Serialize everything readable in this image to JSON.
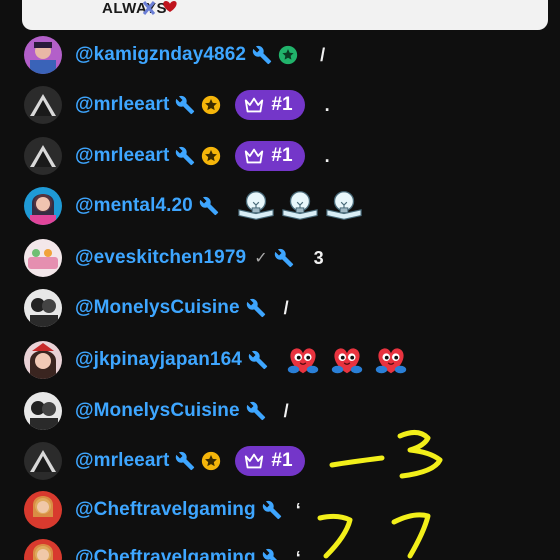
{
  "pinned": {
    "text": "ALWAYS"
  },
  "messages": [
    {
      "author": "@kamigznday4862",
      "text": "/",
      "badges": [
        "wrench-icon",
        "star-badge-icon"
      ]
    },
    {
      "author": "@mrleeart",
      "text": ".",
      "badges": [
        "wrench-icon",
        "gold-star-icon"
      ],
      "rank": "#1"
    },
    {
      "author": "@mrleeart",
      "text": ".",
      "badges": [
        "wrench-icon",
        "gold-star-icon"
      ],
      "rank": "#1"
    },
    {
      "author": "@mental4.20",
      "text": "",
      "badges": [
        "wrench-icon"
      ],
      "emoji": [
        "lightbulb-book-emoji",
        "lightbulb-book-emoji",
        "lightbulb-book-emoji"
      ]
    },
    {
      "author": "@eveskitchen1979",
      "text": "3",
      "badges": [
        "verified-check-icon",
        "wrench-icon"
      ],
      "check": "✓"
    },
    {
      "author": "@MonelysCuisine",
      "text": "/",
      "badges": [
        "wrench-icon"
      ]
    },
    {
      "author": "@jkpinayjapan164",
      "text": "",
      "badges": [
        "wrench-icon"
      ],
      "emoji": [
        "heart-hug-emoji",
        "heart-hug-emoji",
        "heart-hug-emoji"
      ]
    },
    {
      "author": "@MonelysCuisine",
      "text": "/",
      "badges": [
        "wrench-icon"
      ]
    },
    {
      "author": "@mrleeart",
      "text": "",
      "badges": [
        "wrench-icon",
        "gold-star-icon"
      ],
      "rank": "#1"
    },
    {
      "author": "@Cheftravelgaming",
      "text": "‘",
      "badges": [
        "wrench-icon"
      ]
    },
    {
      "author": "@Cheftravelgaming",
      "text": "‘",
      "badges": [
        "wrench-icon"
      ]
    }
  ],
  "colors": {
    "background": "#0f0f0f",
    "author": "#3ea6ff",
    "rank_bg": "#7436c9",
    "scribble": "#f2ef1a"
  }
}
